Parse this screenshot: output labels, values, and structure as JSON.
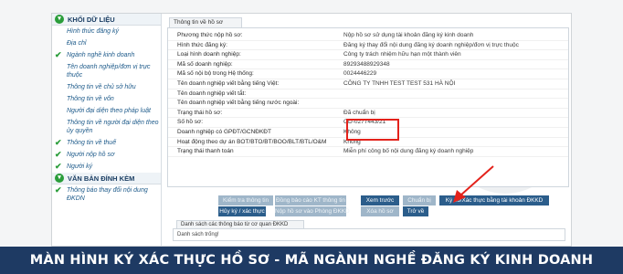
{
  "sidebar": {
    "section1_title": "KHỐI DỮ LIỆU",
    "items": [
      {
        "label": "Hình thức đăng ký",
        "checked": false
      },
      {
        "label": "Địa chỉ",
        "checked": false
      },
      {
        "label": "Ngành nghề kinh doanh",
        "checked": true
      },
      {
        "label": "Tên doanh nghiệp/đơn vị trực thuộc",
        "checked": false
      },
      {
        "label": "Thông tin về chủ sở hữu",
        "checked": false
      },
      {
        "label": "Thông tin về vốn",
        "checked": false
      },
      {
        "label": "Người đại diện theo pháp luật",
        "checked": false
      },
      {
        "label": "Thông tin về người đại diện theo ủy quyền",
        "checked": false
      },
      {
        "label": "Thông tin về thuế",
        "checked": true
      },
      {
        "label": "Người nộp hồ sơ",
        "checked": true
      },
      {
        "label": "Người ký",
        "checked": true
      }
    ],
    "section2_title": "VĂN BẢN ĐÍNH KÈM",
    "attach_items": [
      {
        "label": "Thông báo thay đổi nội dung ĐKDN",
        "checked": true
      }
    ]
  },
  "main": {
    "tab_title": "Thông tin về hồ sơ",
    "rows": [
      {
        "label": "Phương thức nộp hồ sơ:",
        "value": "Nộp hồ sơ sử dụng tài khoản đăng ký kinh doanh"
      },
      {
        "label": "Hình thức đăng ký:",
        "value": "Đăng ký thay đổi nội dung đăng ký doanh nghiệp/đơn vị trực thuộc"
      },
      {
        "label": "Loại hình doanh nghiệp:",
        "value": "Công ty trách nhiệm hữu hạn một thành viên"
      },
      {
        "label": "Mã số doanh nghiệp:",
        "value": "89293488929348"
      },
      {
        "label": "Mã số nội bộ trong Hệ thống:",
        "value": "0024446229"
      },
      {
        "label": "Tên doanh nghiệp viết bằng tiếng Việt:",
        "value": "CÔNG TY TNHH TEST TEST 531 HÀ NỘI"
      },
      {
        "label": "Tên doanh nghiệp viết tắt:",
        "value": ""
      },
      {
        "label": "Tên doanh nghiệp viết bằng tiếng nước ngoài:",
        "value": ""
      },
      {
        "label": "Trạng thái hồ sơ:",
        "value": "Đã chuẩn bị"
      },
      {
        "label": "Số hồ sơ:",
        "value": "OD-0277443/21"
      },
      {
        "label": "Doanh nghiệp có GPĐT/GCNĐKĐT",
        "value": "Không"
      },
      {
        "label": "Hoạt động theo dự án BOT/BTO/BT/BOO/BLT/BTL/O&M",
        "value": "Không"
      },
      {
        "label": "Trạng thái thanh toán",
        "value": "Miễn phí công bố nội dung đăng ký doanh nghiệp"
      }
    ],
    "buttons_row1": [
      {
        "label": "Kiểm tra thông tin",
        "state": "disabled"
      },
      {
        "label": "Đồng bảo cáo KT thông tin",
        "state": "disabled"
      },
      {
        "label": "Xem trước",
        "state": "active"
      },
      {
        "label": "Chuẩn bị",
        "state": "disabled"
      },
      {
        "label": "Ký số/Xác thực bằng tài khoản ĐKKD",
        "state": "active"
      }
    ],
    "buttons_row2": [
      {
        "label": "Hủy ký / xác thực",
        "state": "active"
      },
      {
        "label": "Nộp hồ sơ vào Phòng ĐKKD",
        "state": "disabled"
      },
      {
        "label": "Xóa hồ sơ",
        "state": "disabled"
      },
      {
        "label": "Trở về",
        "state": "active"
      }
    ],
    "list_tab": "Danh sách các thông báo từ cơ quan ĐKKD",
    "list_empty": "Danh sách trống!"
  },
  "banner": "MÀN HÌNH KÝ XÁC THỰC HỒ SƠ - MÃ NGÀNH NGHỀ ĐĂNG KÝ KINH DOANH",
  "colors": {
    "banner_bg": "#1e3a63",
    "highlight": "#e3221b",
    "active_button": "#2b5d8b",
    "check": "#2a9d3a"
  }
}
